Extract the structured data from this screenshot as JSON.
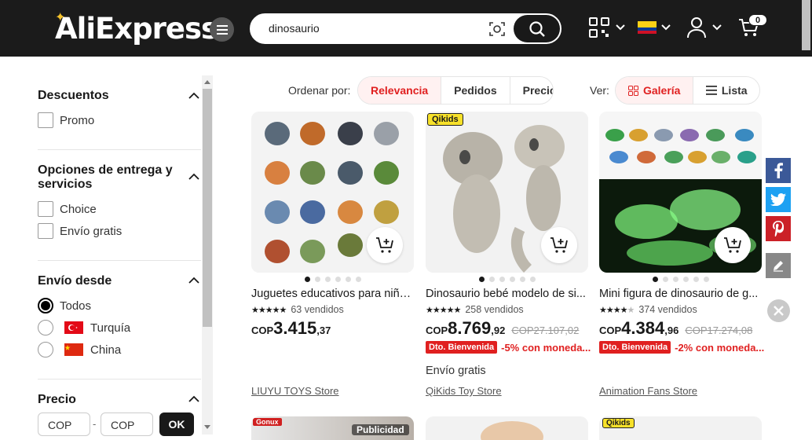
{
  "header": {
    "logo_text": "AliExpress",
    "search_value": "dinosaurio",
    "cart_count": "0",
    "brand_color": "#1b1b1b"
  },
  "sidebar": {
    "discounts": {
      "title": "Descuentos",
      "options": [
        "Promo"
      ]
    },
    "delivery": {
      "title": "Opciones de entrega y servicios",
      "options": [
        "Choice",
        "Envío gratis"
      ]
    },
    "ships_from": {
      "title": "Envío desde",
      "options": [
        "Todos",
        "Turquía",
        "China"
      ],
      "selected": "Todos"
    },
    "price": {
      "title": "Precio",
      "min_placeholder": "COP",
      "max_placeholder": "COP",
      "separator": "-",
      "ok_label": "OK"
    }
  },
  "sort": {
    "label": "Ordenar por:",
    "tabs": [
      "Relevancia",
      "Pedidos",
      "Precio"
    ],
    "active": "Relevancia"
  },
  "view": {
    "label": "Ver:",
    "gallery_label": "Galería",
    "list_label": "Lista",
    "active": "Galería"
  },
  "products": [
    {
      "title": "Juguetes educativos para niños...",
      "stars": 5,
      "sold": "63 vendidos",
      "currency": "COP",
      "price_int": "3.415",
      "price_dec": ",37",
      "old_price": "",
      "badge": "",
      "promo": "",
      "shipping": "",
      "store": "LIUYU TOYS Store",
      "image_badge": ""
    },
    {
      "title": "Dinosaurio bebé modelo de si...",
      "stars": 5,
      "sold": "258 vendidos",
      "currency": "COP",
      "price_int": "8.769",
      "price_dec": ",92",
      "old_price": "COP27.107,02",
      "badge": "Dto. Bienvenida",
      "promo": "-5% con moneda...",
      "shipping": "Envío gratis",
      "store": "QiKids Toy Store",
      "image_badge": "Qikids"
    },
    {
      "title": "Mini figura de dinosaurio de g...",
      "stars": 4.5,
      "sold": "374 vendidos",
      "currency": "COP",
      "price_int": "4.384",
      "price_dec": ",96",
      "old_price": "COP17.274,08",
      "badge": "Dto. Bienvenida",
      "promo": "-2% con moneda...",
      "shipping": "",
      "store": "Animation Fans Store",
      "image_badge": ""
    }
  ],
  "bottom_cards": [
    {
      "overlay": "Publicidad",
      "image_badge": "Gonux"
    },
    {
      "overlay": "",
      "image_badge": ""
    },
    {
      "overlay": "",
      "image_badge": "Qikids"
    }
  ],
  "share": {
    "icons": [
      "facebook-icon",
      "twitter-icon",
      "pinterest-icon",
      "edit-icon"
    ],
    "colors": {
      "facebook": "#3b5998",
      "twitter": "#1da1f2",
      "pinterest": "#cb2027",
      "edit": "#888888"
    }
  },
  "accent_color": "#e02020"
}
